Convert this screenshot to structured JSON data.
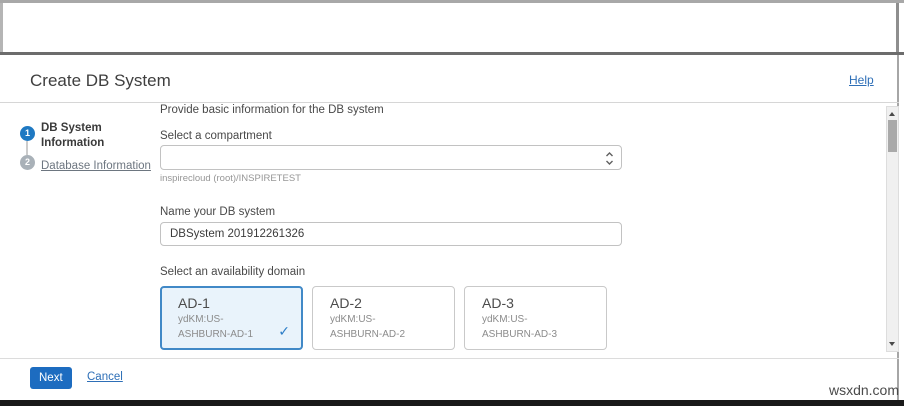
{
  "window": {
    "title": "Create DB System",
    "help": "Help",
    "watermark": "wsxdn.com"
  },
  "wizard": {
    "steps": [
      {
        "number": "1",
        "label": "DB System Information",
        "state": "active"
      },
      {
        "number": "2",
        "label": "Database Information",
        "state": "upcoming"
      }
    ]
  },
  "form": {
    "intro": "Provide basic information for the DB system",
    "compartment": {
      "label": "Select a compartment",
      "selected_value": "",
      "hint": "inspirecloud (root)/INSPIRETEST"
    },
    "db_name": {
      "label": "Name your DB system",
      "value": "DBSystem 201912261326"
    },
    "availability_domain": {
      "label": "Select an availability domain",
      "options": [
        {
          "title": "AD-1",
          "line1": "ydKM:US-",
          "line2": "ASHBURN-AD-1",
          "selected": true,
          "check": "✓"
        },
        {
          "title": "AD-2",
          "line1": "ydKM:US-",
          "line2": "ASHBURN-AD-2",
          "selected": false,
          "check": ""
        },
        {
          "title": "AD-3",
          "line1": "ydKM:US-",
          "line2": "ASHBURN-AD-3",
          "selected": false,
          "check": ""
        }
      ]
    }
  },
  "footer": {
    "next": "Next",
    "cancel": "Cancel"
  },
  "colors": {
    "accent": "#1d6cc0",
    "link": "#2e6fb7",
    "circle-active": "#1f79c2",
    "circle-inactive": "#a9b1b8",
    "card-sel-bg": "#e9f3fb",
    "card-sel-border": "#4189c7",
    "check": "#2c7dc7"
  }
}
